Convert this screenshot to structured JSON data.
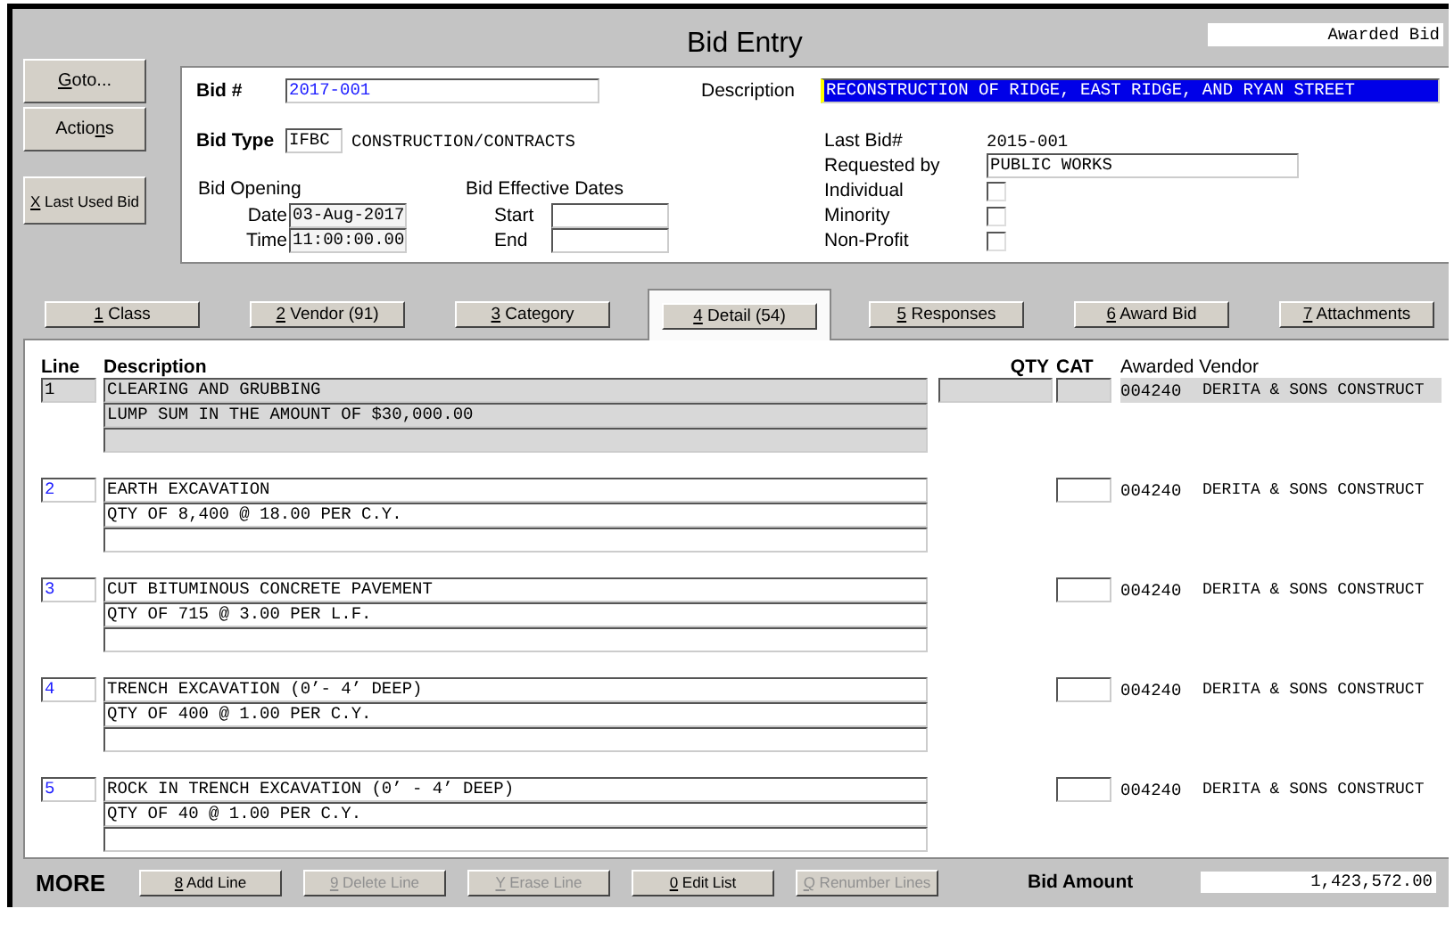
{
  "window": {
    "title": "Bid Entry",
    "status": "Awarded Bid"
  },
  "side_buttons": [
    {
      "key": "G",
      "after": "oto..."
    },
    {
      "before": "Actio",
      "key": "n",
      "after": "s"
    },
    {
      "key": "X",
      "after": " Last Used Bid"
    }
  ],
  "header": {
    "bid_number": {
      "label": "Bid #",
      "value": "2017-001"
    },
    "description": {
      "label": "Description",
      "value": "RECONSTRUCTION OF RIDGE, EAST RIDGE, AND RYAN STREET",
      "highlighted": true
    },
    "bid_type": {
      "label": "Bid Type",
      "code": "IFBC",
      "name": "CONSTRUCTION/CONTRACTS"
    },
    "bid_opening": {
      "title": "Bid Opening",
      "fields": [
        {
          "label": "Date",
          "value": "03-Aug-2017"
        },
        {
          "label": "Time",
          "value": "11:00:00.00"
        }
      ]
    },
    "effective_dates": {
      "title": "Bid Effective Dates",
      "fields": [
        {
          "label": "Start"
        },
        {
          "label": "End"
        }
      ]
    },
    "info": [
      {
        "kind": "text",
        "label": "Last Bid#",
        "value": "2015-001"
      },
      {
        "kind": "field",
        "label": "Requested by",
        "value": "PUBLIC WORKS"
      },
      {
        "kind": "checkbox",
        "label": "Individual",
        "checked": false
      },
      {
        "kind": "checkbox",
        "label": "Minority",
        "checked": false
      },
      {
        "kind": "checkbox",
        "label": "Non-Profit",
        "checked": false
      }
    ]
  },
  "tabs": [
    {
      "key": "1",
      "after": " Class",
      "selected": false
    },
    {
      "key": "2",
      "after": " Vendor (91)",
      "selected": false
    },
    {
      "key": "3",
      "after": " Category",
      "selected": false
    },
    {
      "key": "4",
      "after": " Detail (54)",
      "selected": true
    },
    {
      "key": "5",
      "after": " Responses",
      "selected": false
    },
    {
      "key": "6",
      "after": " Award Bid",
      "selected": false
    },
    {
      "key": "7",
      "after": " Attachments",
      "selected": false
    }
  ],
  "detail": {
    "columns": [
      "Line",
      "Description",
      "QTY",
      "CAT",
      "Awarded Vendor"
    ],
    "rows": [
      {
        "line": "1",
        "description": [
          "CLEARING AND GRUBBING",
          "LUMP SUM IN THE AMOUNT OF $30,000.00"
        ],
        "vendor_code": "004240",
        "vendor_name": "DERITA & SONS CONSTRUCT",
        "selected": true
      },
      {
        "line": "2",
        "description": [
          "EARTH EXCAVATION",
          "QTY OF 8,400 @ 18.00 PER C.Y."
        ],
        "vendor_code": "004240",
        "vendor_name": "DERITA & SONS CONSTRUCT",
        "selected": false
      },
      {
        "line": "3",
        "description": [
          "CUT BITUMINOUS CONCRETE PAVEMENT",
          "QTY OF 715 @ 3.00 PER L.F."
        ],
        "vendor_code": "004240",
        "vendor_name": "DERITA & SONS CONSTRUCT",
        "selected": false
      },
      {
        "line": "4",
        "description": [
          "TRENCH EXCAVATION (0’- 4’ DEEP)",
          "QTY OF 400 @ 1.00 PER C.Y."
        ],
        "vendor_code": "004240",
        "vendor_name": "DERITA & SONS CONSTRUCT",
        "selected": false
      },
      {
        "line": "5",
        "description": [
          "ROCK IN TRENCH EXCAVATION (0’ - 4’ DEEP)",
          "QTY OF 40 @ 1.00 PER C.Y."
        ],
        "vendor_code": "004240",
        "vendor_name": "DERITA & SONS CONSTRUCT",
        "selected": false
      }
    ]
  },
  "footer": {
    "more": "MORE",
    "buttons": [
      {
        "key": "8",
        "after": " Add Line",
        "disabled": false
      },
      {
        "key": "9",
        "after": " Delete Line",
        "disabled": true
      },
      {
        "key": "Y",
        "after": " Erase Line",
        "disabled": true
      },
      {
        "key": "0",
        "after": " Edit List",
        "disabled": false
      },
      {
        "key": "Q",
        "after": " Renumber Lines",
        "disabled": true
      }
    ],
    "amount_label": "Bid Amount",
    "amount": "1,423,572.00"
  }
}
